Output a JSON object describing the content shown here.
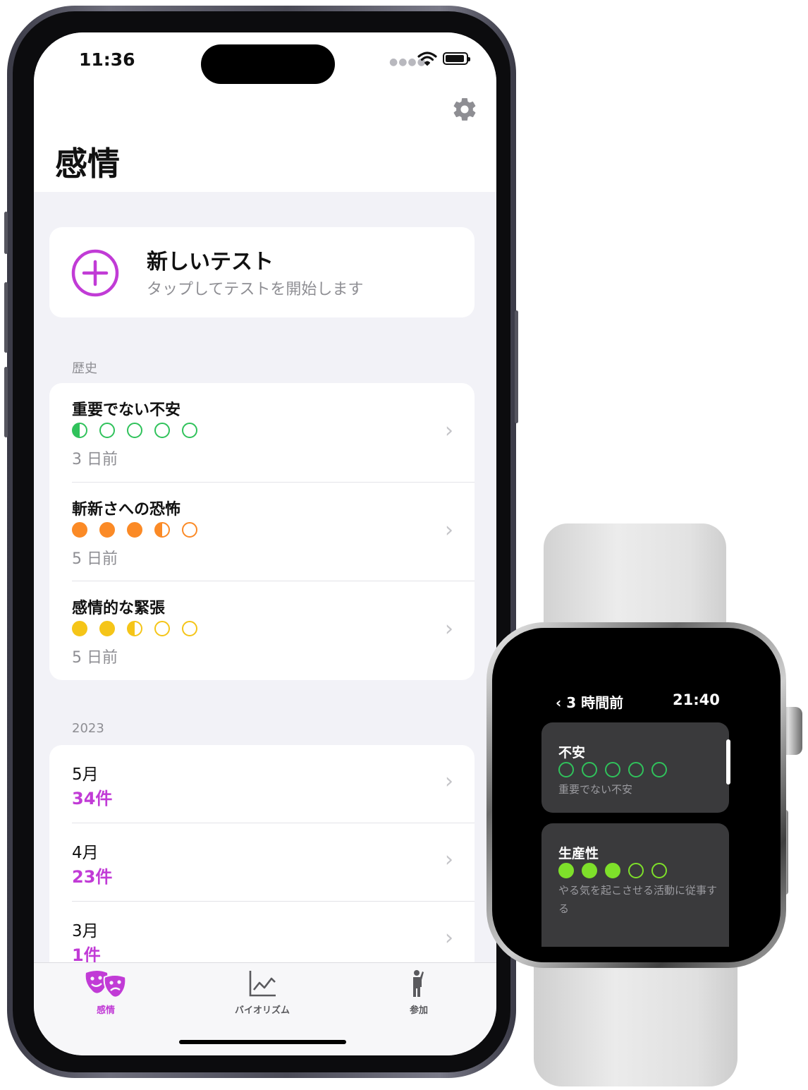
{
  "phone": {
    "status": {
      "time": "11:36"
    },
    "header": {
      "title": "感情"
    },
    "new_test": {
      "title": "新しいテスト",
      "subtitle": "タップしてテストを開始します"
    },
    "history": {
      "label": "歴史",
      "items": [
        {
          "title": "重要でない不安",
          "date": "3 日前",
          "color": "#30c25b",
          "dots": [
            "half",
            "empty",
            "empty",
            "empty",
            "empty"
          ]
        },
        {
          "title": "斬新さへの恐怖",
          "date": "5 日前",
          "color": "#fb8a26",
          "dots": [
            "full",
            "full",
            "full",
            "half",
            "empty"
          ]
        },
        {
          "title": "感情的な緊張",
          "date": "5 日前",
          "color": "#f5c518",
          "dots": [
            "full",
            "full",
            "half",
            "empty",
            "empty"
          ]
        }
      ]
    },
    "year_section": {
      "label": "2023",
      "months": [
        {
          "month": "5月",
          "count": "34件"
        },
        {
          "month": "4月",
          "count": "23件"
        },
        {
          "month": "3月",
          "count": "1件"
        }
      ]
    },
    "tabbar": {
      "accent": "#c13bd6",
      "tabs": [
        {
          "label": "感情",
          "icon": "theater-masks-icon",
          "active": true
        },
        {
          "label": "バイオリズム",
          "icon": "line-chart-icon",
          "active": false
        },
        {
          "label": "参加",
          "icon": "person-icon",
          "active": false
        }
      ]
    }
  },
  "watch": {
    "back_label": "3 時間前",
    "time": "21:40",
    "cards": [
      {
        "title": "不安",
        "subtitle": "重要でない不安",
        "color": "#30c25b",
        "dots": [
          "empty",
          "empty",
          "empty",
          "empty",
          "empty"
        ]
      },
      {
        "title": "生産性",
        "subtitle": "やる気を起こさせる活動に従事する",
        "color": "#7ee02a",
        "dots": [
          "full",
          "full",
          "full",
          "empty",
          "empty"
        ]
      }
    ]
  }
}
